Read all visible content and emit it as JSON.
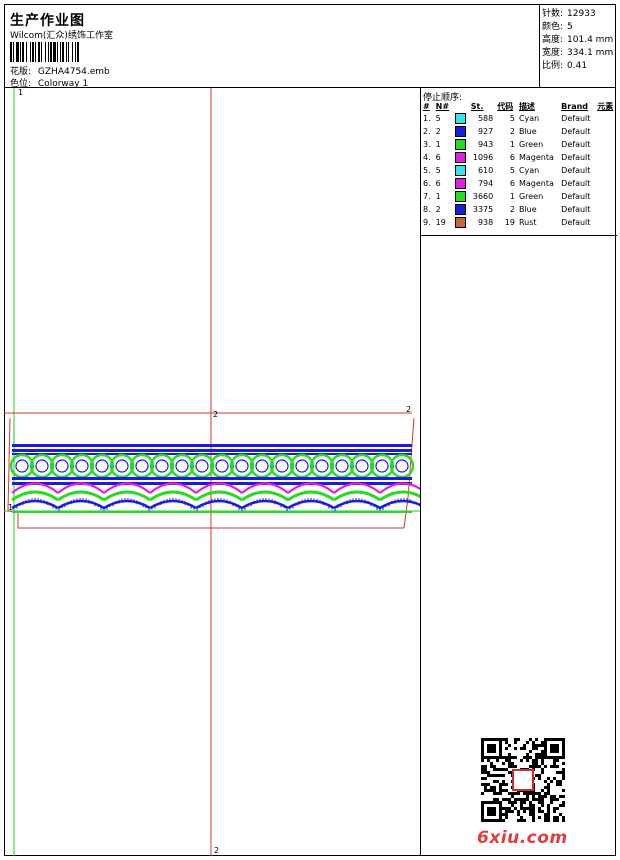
{
  "header": {
    "title": "生产作业图",
    "subtitle": "Wilcom(汇众)绣饰工作室",
    "design_label": "花版:",
    "design_value": "GZHA4754.emb",
    "colorway_label": "色位:",
    "colorway_value": "Colorway 1"
  },
  "stats": {
    "stitches_label": "针数:",
    "stitches_value": "12933",
    "colors_label": "颜色:",
    "colors_value": "5",
    "height_label": "高度:",
    "height_value": "101.4 mm",
    "width_label": "宽度:",
    "width_value": "334.1 mm",
    "scale_label": "比例:",
    "scale_value": "0.41"
  },
  "sequence": {
    "title": "停止顺序:",
    "headers": [
      "#",
      "N#",
      "",
      "St.",
      "代码",
      "描述",
      "Brand",
      "元素"
    ],
    "rows": [
      {
        "idx": "1.",
        "n": "5",
        "color": "#33e6e6",
        "st": "588",
        "code": "5",
        "desc": "Cyan",
        "brand": "Default"
      },
      {
        "idx": "2.",
        "n": "2",
        "color": "#1b1bdc",
        "st": "927",
        "code": "2",
        "desc": "Blue",
        "brand": "Default"
      },
      {
        "idx": "3.",
        "n": "1",
        "color": "#22dd22",
        "st": "943",
        "code": "1",
        "desc": "Green",
        "brand": "Default"
      },
      {
        "idx": "4.",
        "n": "6",
        "color": "#e51de5",
        "st": "1096",
        "code": "6",
        "desc": "Magenta",
        "brand": "Default"
      },
      {
        "idx": "5.",
        "n": "5",
        "color": "#33e6e6",
        "st": "610",
        "code": "5",
        "desc": "Cyan",
        "brand": "Default"
      },
      {
        "idx": "6.",
        "n": "6",
        "color": "#e51de5",
        "st": "794",
        "code": "6",
        "desc": "Magenta",
        "brand": "Default"
      },
      {
        "idx": "7.",
        "n": "1",
        "color": "#22dd22",
        "st": "3660",
        "code": "1",
        "desc": "Green",
        "brand": "Default"
      },
      {
        "idx": "8.",
        "n": "2",
        "color": "#1b1bdc",
        "st": "3375",
        "code": "2",
        "desc": "Blue",
        "brand": "Default"
      },
      {
        "idx": "9.",
        "n": "19",
        "color": "#c8643c",
        "st": "938",
        "code": "19",
        "desc": "Rust",
        "brand": "Default"
      }
    ]
  },
  "canvas": {
    "mark_1_top": "1",
    "mark_1_left": "1",
    "mark_2_right": "2",
    "mark_2_mid": "2",
    "mark_2_bottom": "2"
  },
  "watermark": "6xiu.com",
  "colors": {
    "blue": "#1b1bdc",
    "green": "#22dd22",
    "magenta": "#e51de5",
    "cyan": "#33e6e6",
    "red_guide": "#e03030",
    "green_guide": "#22cc22"
  }
}
